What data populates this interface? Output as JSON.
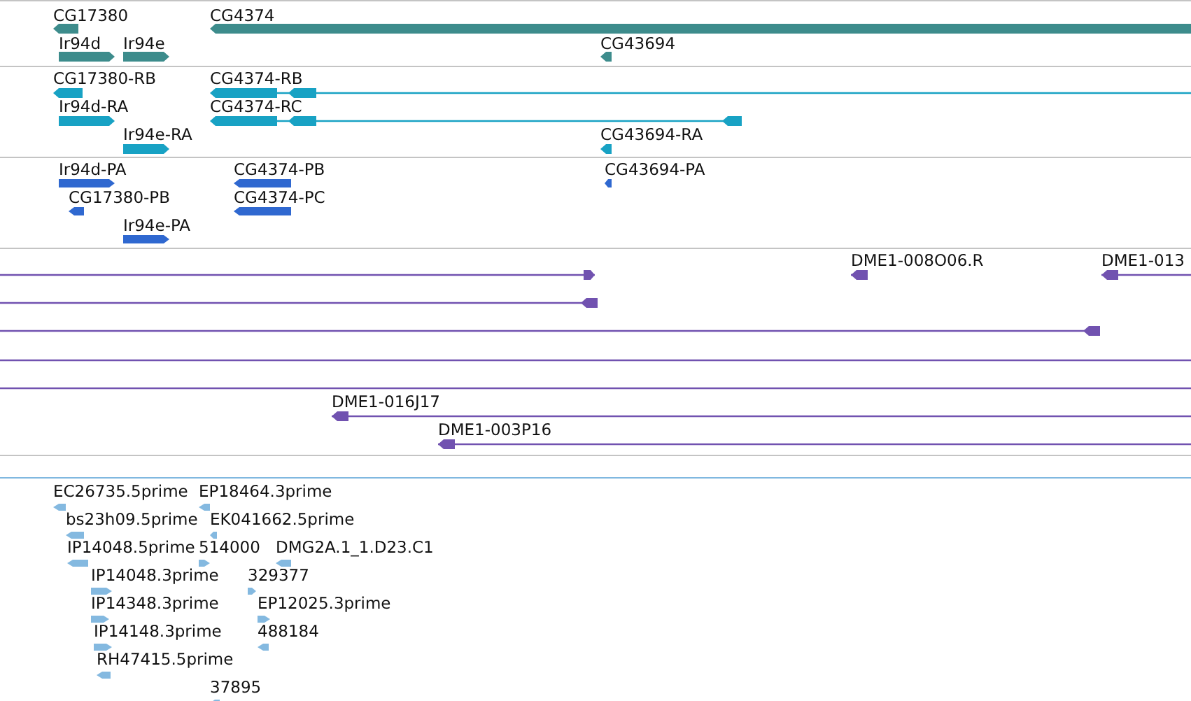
{
  "tracks": [
    {
      "kind": "gene",
      "color": "#3d8c8c",
      "features": [
        {
          "label": "CG17380",
          "kind": "reverse"
        },
        {
          "label": "CG4374",
          "kind": "reverse"
        },
        {
          "label": "Ir94d",
          "kind": "forward"
        },
        {
          "label": "Ir94e",
          "kind": "forward"
        },
        {
          "label": "CG43694",
          "kind": "reverse"
        }
      ]
    },
    {
      "kind": "transcript",
      "color": "#18a2c4",
      "features": [
        {
          "label": "CG17380-RB",
          "kind": "reverse"
        },
        {
          "label": "CG4374-RB",
          "kind": "reverse"
        },
        {
          "label": "Ir94d-RA",
          "kind": "forward"
        },
        {
          "label": "CG4374-RC",
          "kind": "reverse"
        },
        {
          "label": "Ir94e-RA",
          "kind": "forward"
        },
        {
          "label": "CG43694-RA",
          "kind": "reverse"
        }
      ]
    },
    {
      "kind": "protein",
      "color": "#2f68d0",
      "features": [
        {
          "label": "Ir94d-PA",
          "kind": "forward"
        },
        {
          "label": "CG4374-PB",
          "kind": "reverse"
        },
        {
          "label": "CG43694-PA",
          "kind": "reverse"
        },
        {
          "label": "CG17380-PB",
          "kind": "reverse"
        },
        {
          "label": "CG4374-PC",
          "kind": "reverse"
        },
        {
          "label": "Ir94e-PA",
          "kind": "forward"
        }
      ]
    },
    {
      "kind": "clone",
      "color": "#7152b0",
      "features": [
        {
          "kind": "forward"
        },
        {
          "label": "DME1-008O06.R",
          "kind": "reverse"
        },
        {
          "label": "DME1-013",
          "kind": "reverse"
        },
        {
          "kind": "reverse"
        },
        {
          "kind": "reverse"
        },
        {
          "kind": "plain"
        },
        {
          "kind": "plain"
        },
        {
          "label": "DME1-016J17",
          "kind": "reverse"
        },
        {
          "label": "DME1-003P16",
          "kind": "reverse"
        }
      ]
    },
    {
      "kind": "est",
      "color": "#84b9e0",
      "features": [
        {
          "label": "EC26735.5prime",
          "kind": "reverse"
        },
        {
          "label": "EP18464.3prime",
          "kind": "reverse"
        },
        {
          "label": "bs23h09.5prime",
          "kind": "reverse"
        },
        {
          "label": "EK041662.5prime",
          "kind": "reverse"
        },
        {
          "label": "IP14048.5prime",
          "kind": "reverse"
        },
        {
          "label": "514000",
          "kind": "forward"
        },
        {
          "label": "DMG2A.1_1.D23.C1",
          "kind": "reverse"
        },
        {
          "label": "IP14048.3prime",
          "kind": "forward"
        },
        {
          "label": "329377",
          "kind": "forward"
        },
        {
          "label": "IP14348.3prime",
          "kind": "forward"
        },
        {
          "label": "EP12025.3prime",
          "kind": "forward"
        },
        {
          "label": "IP14148.3prime",
          "kind": "forward"
        },
        {
          "label": "488184",
          "kind": "reverse"
        },
        {
          "label": "RH47415.5prime",
          "kind": "reverse"
        },
        {
          "label": "37895",
          "kind": "reverse"
        }
      ]
    }
  ]
}
